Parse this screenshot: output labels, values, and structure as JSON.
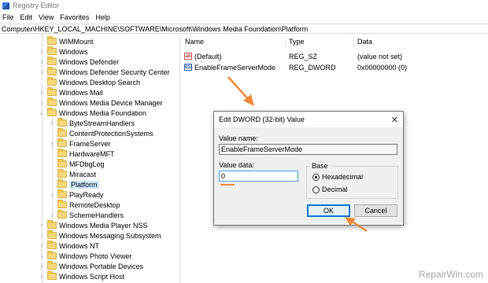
{
  "window": {
    "title": "Registry Editor"
  },
  "menu": [
    "File",
    "Edit",
    "View",
    "Favorites",
    "Help"
  ],
  "address": "Computer\\HKEY_LOCAL_MACHINE\\SOFTWARE\\Microsoft\\Windows Media Foundation\\Platform",
  "tree": {
    "items": [
      {
        "label": "WIMMount",
        "level": 1,
        "expander": ""
      },
      {
        "label": "Windows",
        "level": 1,
        "expander": "›"
      },
      {
        "label": "Windows Defender",
        "level": 1,
        "expander": "›"
      },
      {
        "label": "Windows Defender Security Center",
        "level": 1,
        "expander": "›"
      },
      {
        "label": "Windows Desktop Search",
        "level": 1,
        "expander": ""
      },
      {
        "label": "Windows Mail",
        "level": 1,
        "expander": "›"
      },
      {
        "label": "Windows Media Device Manager",
        "level": 1,
        "expander": "›"
      },
      {
        "label": "Windows Media Foundation",
        "level": 1,
        "expander": "⌄"
      },
      {
        "label": "ByteStreamHandlers",
        "level": 2,
        "expander": "›"
      },
      {
        "label": "ContentProtectionSystems",
        "level": 2,
        "expander": ""
      },
      {
        "label": "FrameServer",
        "level": 2,
        "expander": "›"
      },
      {
        "label": "HardwareMFT",
        "level": 2,
        "expander": ""
      },
      {
        "label": "MFDbgLog",
        "level": 2,
        "expander": ""
      },
      {
        "label": "Miracast",
        "level": 2,
        "expander": ""
      },
      {
        "label": "Platform",
        "level": 2,
        "expander": "",
        "selected": true
      },
      {
        "label": "PlayReady",
        "level": 2,
        "expander": "›"
      },
      {
        "label": "RemoteDesktop",
        "level": 2,
        "expander": ""
      },
      {
        "label": "SchemeHandlers",
        "level": 2,
        "expander": "›"
      },
      {
        "label": "Windows Media Player NSS",
        "level": 1,
        "expander": "›"
      },
      {
        "label": "Windows Messaging Subsystem",
        "level": 1,
        "expander": "›"
      },
      {
        "label": "Windows NT",
        "level": 1,
        "expander": "›"
      },
      {
        "label": "Windows Photo Viewer",
        "level": 1,
        "expander": "›"
      },
      {
        "label": "Windows Portable Devices",
        "level": 1,
        "expander": "›"
      },
      {
        "label": "Windows Script Host",
        "level": 1,
        "expander": "›"
      }
    ]
  },
  "list": {
    "columns": [
      "Name",
      "Type",
      "Data"
    ],
    "rows": [
      {
        "name": "(Default)",
        "type": "REG_SZ",
        "data": "(value not set)",
        "icon": "string-value-icon"
      },
      {
        "name": "EnableFrameServerMode",
        "type": "REG_DWORD",
        "data": "0x00000000 (0)",
        "icon": "dword-value-icon"
      }
    ]
  },
  "dialog": {
    "title": "Edit DWORD (32-bit) Value",
    "close": "✕",
    "value_name_label": "Value name:",
    "value_name": "EnableFrameServerMode",
    "value_data_label": "Value data:",
    "value_data": "0",
    "base_label": "Base",
    "hex_label": "Hexadecimal",
    "dec_label": "Decimal",
    "base_selected": "Hexadecimal",
    "ok_label": "OK",
    "cancel_label": "Cancel"
  },
  "icons": {
    "regsz": "ab",
    "regdword": "011"
  },
  "watermark": "RepairWin.com",
  "colors": {
    "accent": "#0078d7",
    "annotation": "#f0893a",
    "selection": "#cce8ff"
  }
}
